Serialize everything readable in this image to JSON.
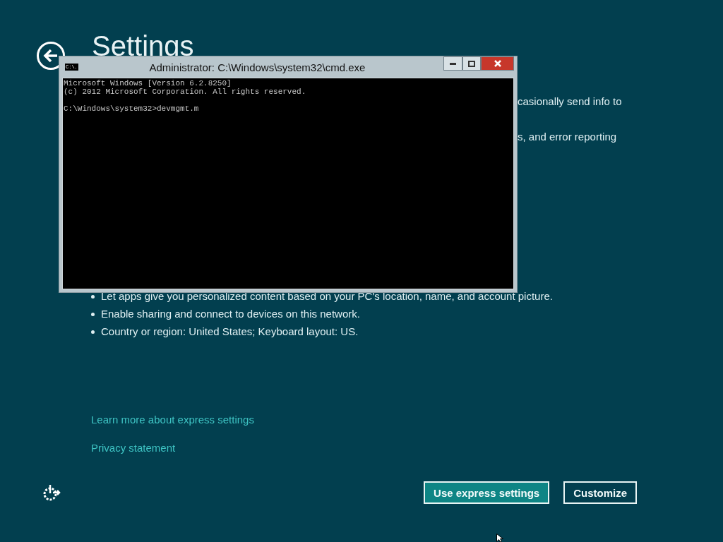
{
  "page": {
    "title": "Settings"
  },
  "partial_lines": [
    "casionally send info to",
    "s, and error reporting"
  ],
  "bullets": [
    "Let apps give you personalized content based on your PC's location, name, and account picture.",
    "Enable sharing and connect to devices on this network.",
    "Country or region: United States; Keyboard layout: US."
  ],
  "links": [
    "Learn more about express settings",
    "Privacy statement"
  ],
  "buttons": [
    {
      "label": "Use express settings",
      "kind": "primary"
    },
    {
      "label": "Customize",
      "kind": "secondary"
    }
  ],
  "console_window": {
    "title": "Administrator: C:\\Windows\\system32\\cmd.exe",
    "icon_label": "C:\\.",
    "blocks": [
      [
        "Microsoft Windows [Version 6.2.8250]",
        "(c) 2012 Microsoft Corporation. All rights reserved."
      ],
      [
        "C:\\Windows\\system32>devmgmt.m"
      ]
    ]
  }
}
